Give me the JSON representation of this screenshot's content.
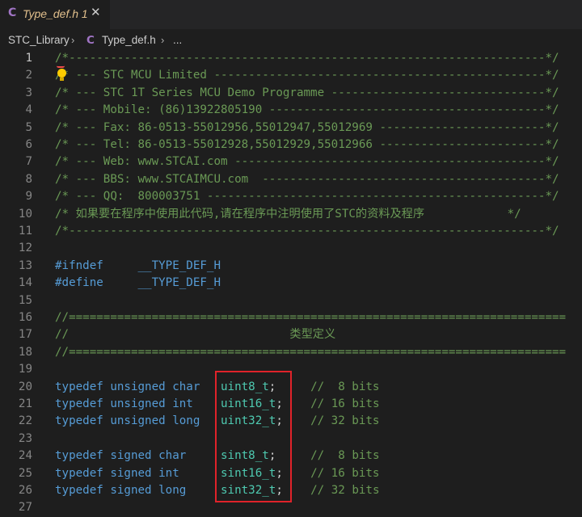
{
  "tab": {
    "icon": "C",
    "title": "Type_def.h 1",
    "close": "✕"
  },
  "breadcrumb": {
    "root": "STC_Library",
    "sep1": "›",
    "file_icon": "C",
    "file": "Type_def.h",
    "sep2": "›",
    "more": "..."
  },
  "lines": [
    {
      "n": "1",
      "text": "/*---------------------------------------------------------------------*/"
    },
    {
      "n": "2",
      "text": "/* --- STC MCU Limited ------------------------------------------------*/"
    },
    {
      "n": "3",
      "text": "/* --- STC 1T Series MCU Demo Programme -------------------------------*/"
    },
    {
      "n": "4",
      "text": "/* --- Mobile: (86)13922805190 ----------------------------------------*/"
    },
    {
      "n": "5",
      "text": "/* --- Fax: 86-0513-55012956,55012947,55012969 ------------------------*/"
    },
    {
      "n": "6",
      "text": "/* --- Tel: 86-0513-55012928,55012929,55012966 ------------------------*/"
    },
    {
      "n": "7",
      "text": "/* --- Web: www.STCAI.com ---------------------------------------------*/"
    },
    {
      "n": "8",
      "text": "/* --- BBS: www.STCAIMCU.com  -----------------------------------------*/"
    },
    {
      "n": "9",
      "text": "/* --- QQ:  800003751 -------------------------------------------------*/"
    },
    {
      "n": "10",
      "text": "/* 如果要在程序中使用此代码,请在程序中注明使用了STC的资料及程序            */"
    },
    {
      "n": "11",
      "text": "/*---------------------------------------------------------------------*/"
    },
    {
      "n": "12",
      "text": ""
    },
    {
      "n": "13",
      "kw": "#ifndef",
      "gap": "     ",
      "macro": "__TYPE_DEF_H"
    },
    {
      "n": "14",
      "kw": "#define",
      "gap": "     ",
      "macro": "__TYPE_DEF_H"
    },
    {
      "n": "15",
      "text": ""
    },
    {
      "n": "16",
      "text": "//========================================================================"
    },
    {
      "n": "17",
      "text": "//                                类型定义"
    },
    {
      "n": "18",
      "text": "//========================================================================"
    },
    {
      "n": "19",
      "text": ""
    },
    {
      "n": "20",
      "kw": "typedef unsigned char",
      "gap": "   ",
      "type": "uint8_t",
      "semi": ";",
      "cgap": "     ",
      "comment": "//  8 bits"
    },
    {
      "n": "21",
      "kw": "typedef unsigned int",
      "gap": "    ",
      "type": "uint16_t",
      "semi": ";",
      "cgap": "    ",
      "comment": "// 16 bits"
    },
    {
      "n": "22",
      "kw": "typedef unsigned long",
      "gap": "   ",
      "type": "uint32_t",
      "semi": ";",
      "cgap": "    ",
      "comment": "// 32 bits"
    },
    {
      "n": "23",
      "text": ""
    },
    {
      "n": "24",
      "kw": "typedef signed char",
      "gap": "     ",
      "type": "sint8_t",
      "semi": ";",
      "cgap": "     ",
      "comment": "//  8 bits"
    },
    {
      "n": "25",
      "kw": "typedef signed int",
      "gap": "      ",
      "type": "sint16_t",
      "semi": ";",
      "cgap": "    ",
      "comment": "// 16 bits"
    },
    {
      "n": "26",
      "kw": "typedef signed long",
      "gap": "     ",
      "type": "sint32_t",
      "semi": ";",
      "cgap": "    ",
      "comment": "// 32 bits"
    },
    {
      "n": "27",
      "text": ""
    }
  ]
}
